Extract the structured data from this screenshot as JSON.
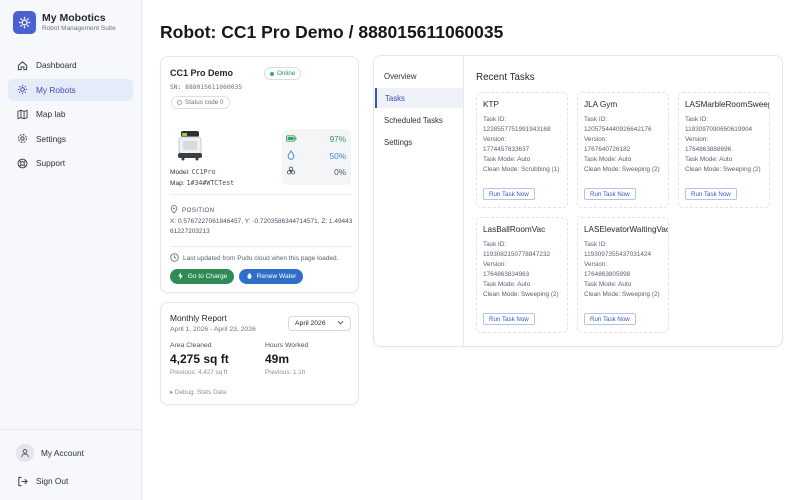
{
  "brand": {
    "title": "My Mobotics",
    "subtitle": "Robot Management Suite"
  },
  "nav": {
    "items": [
      {
        "label": "Dashboard",
        "icon": "home-icon"
      },
      {
        "label": "My Robots",
        "icon": "robot-icon",
        "active": true
      },
      {
        "label": "Map lab",
        "icon": "map-icon"
      },
      {
        "label": "Settings",
        "icon": "gear-icon"
      },
      {
        "label": "Support",
        "icon": "support-icon"
      }
    ],
    "account": "My Account",
    "signout": "Sign Out"
  },
  "page": {
    "title": "Robot: CC1 Pro Demo / 888015611060035"
  },
  "robot": {
    "name": "CC1 Pro Demo",
    "online": "Online",
    "sn": "SN: 888015611060035",
    "status": "Status code 0",
    "model_label": "Model:",
    "model": "CC1Pro",
    "map_label": "Map:",
    "map": "1#34#WTCTest",
    "battery": "97%",
    "water": "50%",
    "waste": "0%",
    "position_label": "POSITION",
    "position": "X: 0.5767227061846457, Y: -0.7203586344714571, Z: 1.4944361227203213",
    "updated": "Last updated from Pudu cloud when this page loaded.",
    "charge_btn": "Go to Charge",
    "water_btn": "Renew Water"
  },
  "report": {
    "title": "Monthly Report",
    "range": "April 1, 2026 - April 23, 2026",
    "month": "April 2026",
    "area_label": "Area Cleaned",
    "area_value": "4,275 sq ft",
    "area_prev": "Previous: 4,427 sq ft",
    "hours_label": "Hours Worked",
    "hours_value": "49m",
    "hours_prev": "Previous: 1.1h",
    "debug": "▸ Debug: Stats Data"
  },
  "tabs": [
    "Overview",
    "Tasks",
    "Scheduled Tasks",
    "Settings"
  ],
  "recent_title": "Recent Tasks",
  "run_label": "Run Task Now",
  "tasks": [
    {
      "name": "KTP",
      "id_label": "Task ID:",
      "id": "1228557751991943168",
      "ver_label": "Version:",
      "version": "1774457833637",
      "mode": "Task Mode: Auto",
      "clean": "Clean Mode: Scrubbing (1)"
    },
    {
      "name": "JLA Gym",
      "id_label": "Task ID:",
      "id": "1205754440926642176",
      "ver_label": "Version:",
      "version": "1767640726182",
      "mode": "Task Mode: Auto",
      "clean": "Clean Mode: Sweeping (2)"
    },
    {
      "name": "LASMarbleRoomSweepVac",
      "id_label": "Task ID:",
      "id": "1193097090650619904",
      "ver_label": "Version:",
      "version": "1764863888696",
      "mode": "Task Mode: Auto",
      "clean": "Clean Mode: Sweeping (2)"
    },
    {
      "name": "LasBallRoomVac",
      "id_label": "Task ID:",
      "id": "1193082150778847232",
      "ver_label": "Version:",
      "version": "1764863834963",
      "mode": "Task Mode: Auto",
      "clean": "Clean Mode: Sweeping (2)"
    },
    {
      "name": "LASElevatorWaitingVac",
      "id_label": "Task ID:",
      "id": "1193097355437031424",
      "ver_label": "Version:",
      "version": "1764863805998",
      "mode": "Task Mode: Auto",
      "clean": "Clean Mode: Sweeping (2)"
    }
  ]
}
